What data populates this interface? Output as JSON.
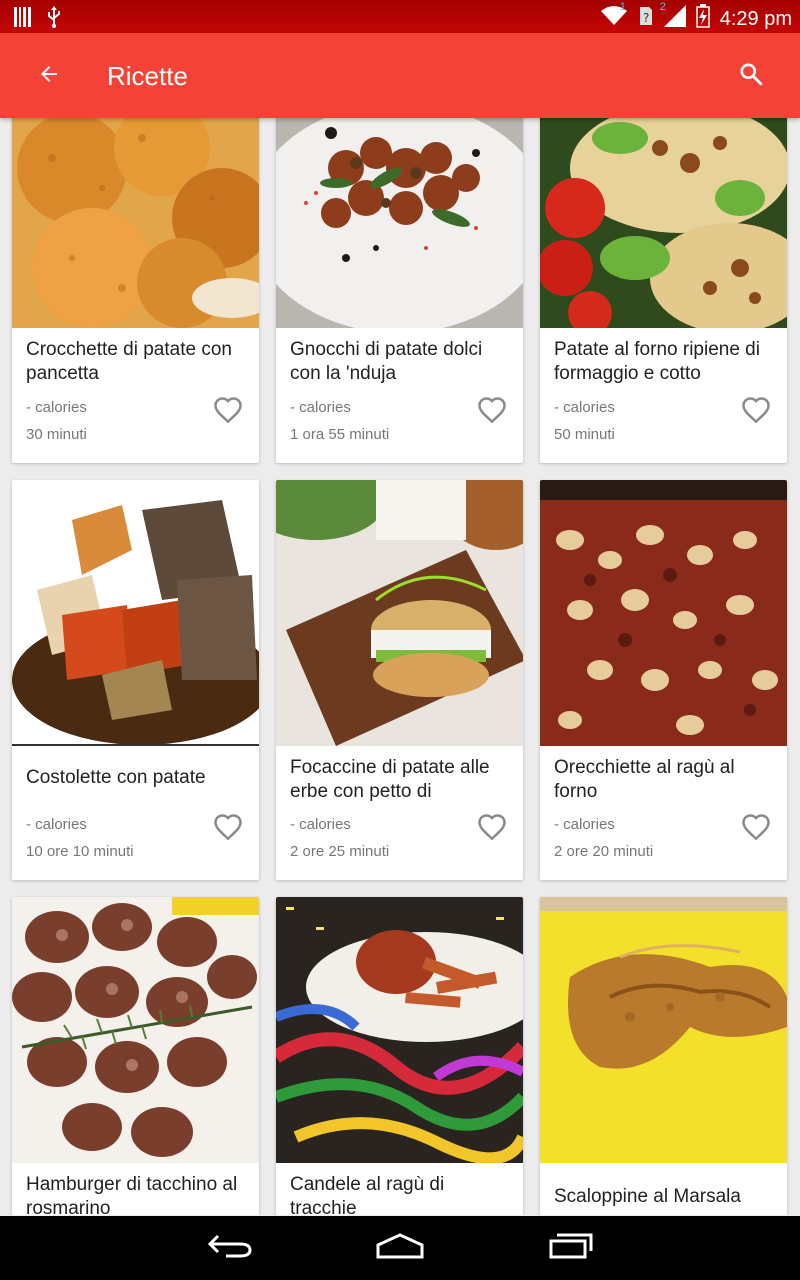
{
  "status_bar": {
    "time": "4:29 pm",
    "sim1": "1",
    "sim2": "2",
    "icons": [
      "barcode-icon",
      "usb-icon",
      "wifi-icon",
      "sim-icon",
      "signal-icon",
      "battery-charging-icon"
    ]
  },
  "app_bar": {
    "title": "Ricette",
    "back_icon": "arrow-back-icon",
    "search_icon": "search-icon",
    "color": "#f44336"
  },
  "recipes": [
    {
      "title": "Crocchette di patate con pancetta",
      "calories": "- calories",
      "duration": "30 minuti"
    },
    {
      "title": "Gnocchi di patate dolci con la 'nduja",
      "calories": "- calories",
      "duration": "1 ora 55 minuti"
    },
    {
      "title": "Patate al forno ripiene di formaggio e cotto",
      "calories": "- calories",
      "duration": "50 minuti"
    },
    {
      "title": "Costolette con patate",
      "calories": "- calories",
      "duration": "10 ore 10 minuti"
    },
    {
      "title": "Focaccine di patate alle erbe con petto di",
      "calories": "- calories",
      "duration": "2 ore 25 minuti"
    },
    {
      "title": "Orecchiette al ragù al forno",
      "calories": "- calories",
      "duration": "2 ore 20 minuti"
    },
    {
      "title": "Hamburger di tacchino al rosmarino",
      "calories": "",
      "duration": ""
    },
    {
      "title": "Candele al ragù di tracchie",
      "calories": "",
      "duration": ""
    },
    {
      "title": "Scaloppine al Marsala",
      "calories": "",
      "duration": ""
    }
  ],
  "nav_bar": {
    "icons": [
      "back-nav-icon",
      "home-nav-icon",
      "recents-nav-icon"
    ]
  }
}
